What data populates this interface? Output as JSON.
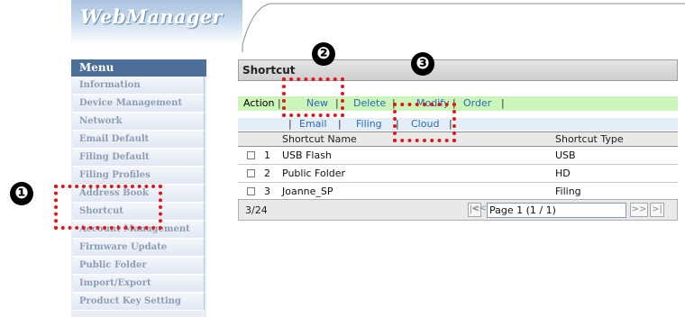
{
  "app": {
    "logo": "WebManager"
  },
  "sidebar": {
    "header": "Menu",
    "items": [
      {
        "label": "Information"
      },
      {
        "label": "Device Management"
      },
      {
        "label": "Network"
      },
      {
        "label": "Email Default"
      },
      {
        "label": "Filing Default"
      },
      {
        "label": "Filing Profiles"
      },
      {
        "label": "Address Book"
      },
      {
        "label": "Shortcut"
      },
      {
        "label": "Account Management"
      },
      {
        "label": "Firmware Update"
      },
      {
        "label": "Public Folder"
      },
      {
        "label": "Import/Export"
      },
      {
        "label": "Product Key Setting"
      }
    ]
  },
  "main": {
    "title": "Shortcut",
    "action_label": "Action",
    "actions": {
      "new": "New",
      "delete": "Delete",
      "modify": "Modify",
      "order": "Order"
    },
    "sub_actions": {
      "email": "Email",
      "filing": "Filing",
      "cloud": "Cloud"
    },
    "table": {
      "columns": {
        "name": "Shortcut Name",
        "type": "Shortcut Type"
      },
      "rows": [
        {
          "num": "1",
          "name": "USB Flash",
          "type": "USB"
        },
        {
          "num": "2",
          "name": "Public Folder",
          "type": "HD"
        },
        {
          "num": "3",
          "name": "Joanne_SP",
          "type": "Filing"
        }
      ]
    },
    "pagination": {
      "count": "3/24",
      "first": "|<",
      "prev": "<<",
      "page_label": "Page 1 (1 / 1)",
      "next": ">>",
      "last": ">|"
    }
  },
  "callouts": [
    "❶",
    "❷",
    "❸"
  ],
  "colors": {
    "callout_red": "#e0171b",
    "menu_header": "#4c6f99",
    "action_bar": "#ccf5b9",
    "link": "#2a6ab8"
  }
}
